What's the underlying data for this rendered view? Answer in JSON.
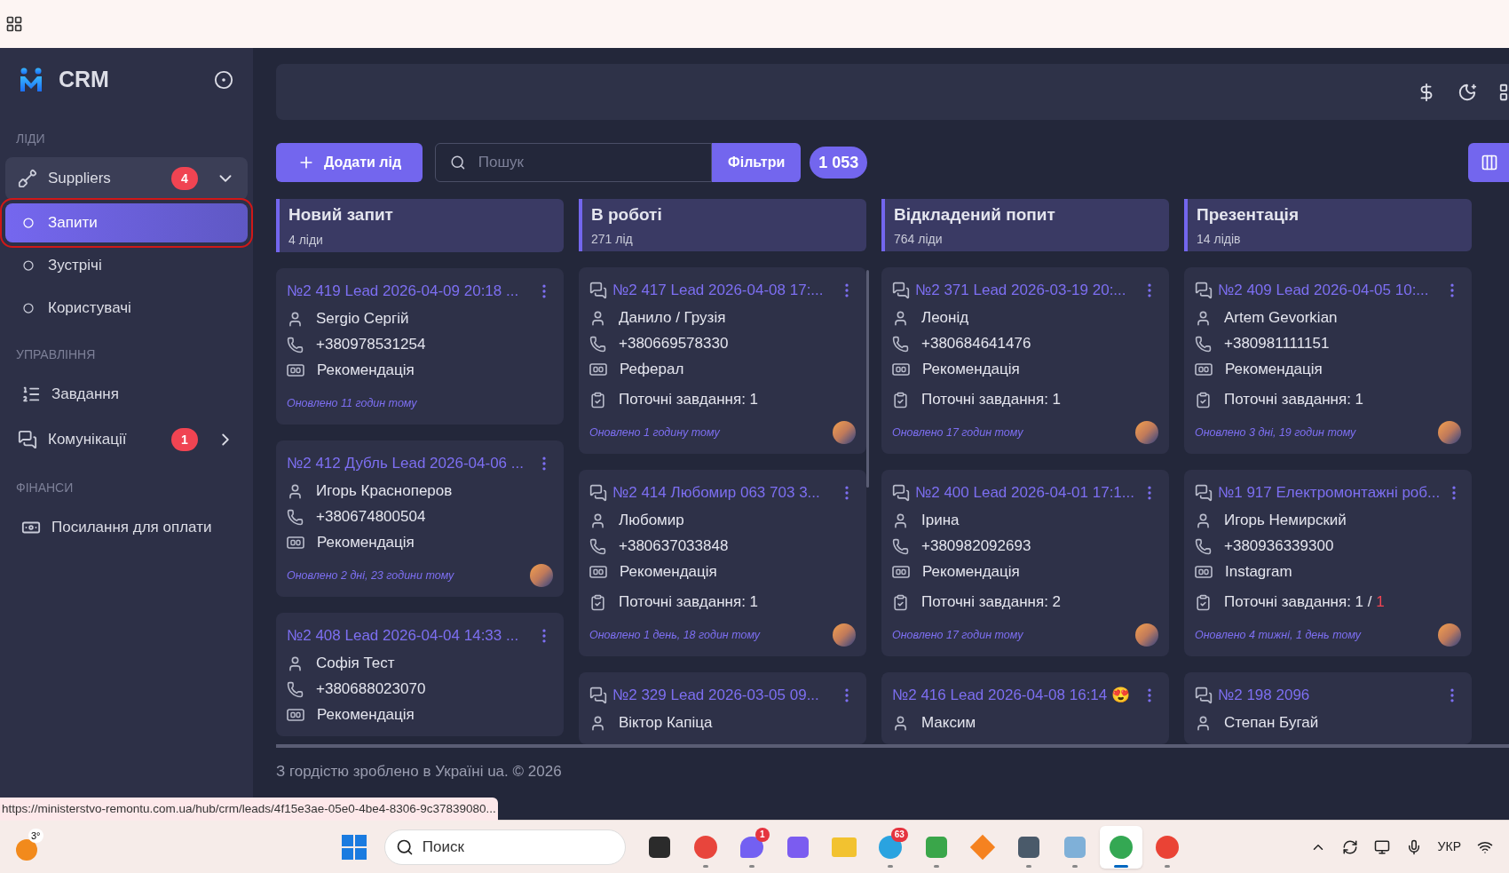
{
  "sidebar": {
    "logo": "CRM",
    "sections": [
      {
        "title": "ЛІДИ",
        "items": [
          {
            "kind": "group",
            "label": "Suppliers",
            "badge": "4",
            "expanded": true,
            "children": [
              {
                "label": "Запити",
                "selected": true
              },
              {
                "label": "Зустрічі",
                "selected": false
              },
              {
                "label": "Користувачі",
                "selected": false
              }
            ]
          }
        ]
      },
      {
        "title": "УПРАВЛІННЯ",
        "items": [
          {
            "kind": "link",
            "label": "Завдання"
          },
          {
            "kind": "group",
            "label": "Комунікації",
            "badge": "1",
            "expanded": false
          }
        ]
      },
      {
        "title": "ФІНАНСИ",
        "items": [
          {
            "kind": "link",
            "label": "Посилання для оплати"
          }
        ]
      }
    ]
  },
  "toolbar": {
    "add_button": "Додати лід",
    "search_placeholder": "Пошук",
    "filters_button": "Фільтри",
    "total": "1 053"
  },
  "columns": [
    {
      "title": "Новий запит",
      "count": "4 ліди",
      "scrollbar": false,
      "cards": [
        {
          "chat": false,
          "title": "№2 419 Lead 2026-04-09 20:18 ...",
          "contact": "Sergio Сергій",
          "phone": "+380978531254",
          "source": "Рекомендація",
          "updated": "Оновлено 11 годин тому",
          "avatar": false
        },
        {
          "chat": false,
          "title": "№2 412 Дубль Lead 2026-04-06 ...",
          "contact": "Игорь Красноперов",
          "phone": "+380674800504",
          "source": "Рекомендація",
          "updated": "Оновлено 2 дні, 23 години тому",
          "avatar": true
        },
        {
          "chat": false,
          "title": "№2 408 Lead 2026-04-04 14:33 ...",
          "contact": "Софія Тест",
          "phone": "+380688023070",
          "source": "Рекомендація"
        }
      ]
    },
    {
      "title": "В роботі",
      "count": "271 лід",
      "scrollbar": true,
      "cards": [
        {
          "chat": true,
          "title": "№2 417 Lead 2026-04-08 17:...",
          "contact": "Данило / Грузія",
          "phone": "+380669578330",
          "source": "Реферал",
          "tasks": "Поточні завдання: 1",
          "updated": "Оновлено 1 годину тому",
          "avatar": true
        },
        {
          "chat": true,
          "title": "№2 414 Любомир 063 703 3...",
          "contact": "Любомир",
          "phone": "+380637033848",
          "source": "Рекомендація",
          "tasks": "Поточні завдання: 1",
          "updated": "Оновлено 1 день, 18 годин тому",
          "avatar": true
        },
        {
          "chat": true,
          "title": "№2 329 Lead 2026-03-05 09...",
          "contact": "Віктор Капіца"
        }
      ]
    },
    {
      "title": "Відкладений попит",
      "count": "764 ліди",
      "scrollbar": false,
      "cards": [
        {
          "chat": true,
          "title": "№2 371 Lead 2026-03-19 20:...",
          "contact": "Леонід",
          "phone": "+380684641476",
          "source": "Рекомендація",
          "tasks": "Поточні завдання: 1",
          "updated": "Оновлено 17 годин тому",
          "avatar": true
        },
        {
          "chat": true,
          "title": "№2 400 Lead 2026-04-01 17:1...",
          "contact": "Ірина",
          "phone": "+380982092693",
          "source": "Рекомендація",
          "tasks": "Поточні завдання: 2",
          "updated": "Оновлено 17 годин тому",
          "avatar": true
        },
        {
          "chat": false,
          "title": "№2 416 Lead 2026-04-08 16:14 😍",
          "contact": "Максим"
        }
      ]
    },
    {
      "title": "Презентація",
      "count": "14 лідів",
      "scrollbar": false,
      "cards": [
        {
          "chat": true,
          "title": "№2 409 Lead 2026-04-05 10:...",
          "contact": "Artem Gevorkian",
          "phone": "+380981111151",
          "source": "Рекомендація",
          "tasks": "Поточні завдання: 1",
          "updated": "Оновлено 3 дні, 19 годин тому",
          "avatar": true
        },
        {
          "chat": true,
          "title": "№1 917 Електромонтажні роб...",
          "contact": "Игорь Немирский",
          "phone": "+380936339300",
          "source": "Instagram",
          "tasks": "Поточні завдання: 1 /",
          "tasks_overdue": "1",
          "updated": "Оновлено 4 тижні, 1 день тому",
          "avatar": true
        },
        {
          "chat": true,
          "title": "№2 198 2096",
          "contact": "Степан Бугай"
        }
      ]
    }
  ],
  "footer": "З гордістю зроблено в Україні ua. © 2026",
  "status_url": "https://ministerstvo-remontu.com.ua/hub/crm/leads/4f15e3ae-05e0-4be4-8306-9c37839080...",
  "taskbar": {
    "weather": "3°",
    "search_placeholder": "Поиск",
    "apps": [
      {
        "kind": "square",
        "color": "#2b2b2b",
        "running": false,
        "active": false
      },
      {
        "kind": "circle",
        "color": "#e8453c",
        "running": true,
        "active": false
      },
      {
        "kind": "bubble",
        "color": "#7360f2",
        "badge": "1",
        "running": true,
        "active": false
      },
      {
        "kind": "square",
        "color": "#7b5cf0",
        "running": false,
        "active": false
      },
      {
        "kind": "folder",
        "color": "#f2c230",
        "running": false,
        "active": false
      },
      {
        "kind": "circle",
        "color": "#2aa3e0",
        "badge": "63",
        "running": true,
        "active": false
      },
      {
        "kind": "square",
        "color": "#3aa64a",
        "running": true,
        "active": false
      },
      {
        "kind": "diamond",
        "color": "#f58220",
        "running": false,
        "active": false
      },
      {
        "kind": "square",
        "color": "#4a5a6a",
        "running": true,
        "active": false
      },
      {
        "kind": "square",
        "color": "#7fb0d8",
        "running": true,
        "active": false
      },
      {
        "kind": "circle",
        "color": "#34a853",
        "running": true,
        "active": true
      },
      {
        "kind": "circle",
        "color": "#ea4335",
        "running": true,
        "active": false
      }
    ],
    "language": "УКР"
  }
}
